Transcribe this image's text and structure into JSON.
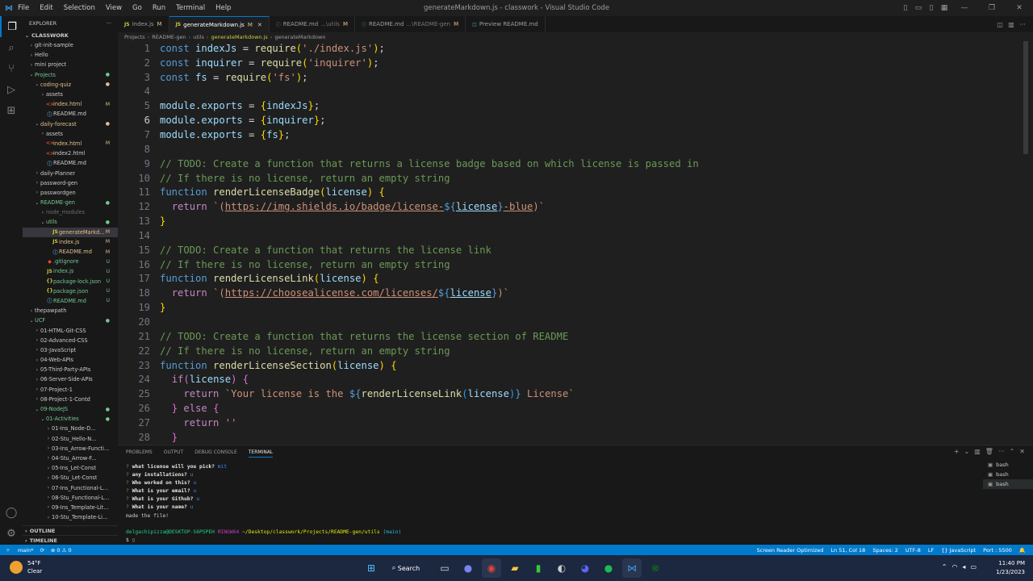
{
  "titlebar": {
    "menu": [
      "File",
      "Edit",
      "Selection",
      "View",
      "Go",
      "Run",
      "Terminal",
      "Help"
    ],
    "title": "generateMarkdown.js - classwork - Visual Studio Code"
  },
  "sidebar": {
    "header": "EXPLORER",
    "root": "CLASSWORK",
    "items": [
      {
        "name": "git-init-sample",
        "depth": 1,
        "type": "folder",
        "open": false,
        "badge": "",
        "badge_color": ""
      },
      {
        "name": "Hello",
        "depth": 1,
        "type": "folder",
        "open": false,
        "badge": "",
        "badge_color": ""
      },
      {
        "name": "mini project",
        "depth": 1,
        "type": "folder",
        "open": false,
        "badge": "",
        "badge_color": ""
      },
      {
        "name": "Projects",
        "depth": 1,
        "type": "folder",
        "open": true,
        "badge": "●",
        "badge_color": "#73c991",
        "color": "#73c991"
      },
      {
        "name": "coding-quiz",
        "depth": 2,
        "type": "folder",
        "open": true,
        "badge": "●",
        "badge_color": "#e2c08d",
        "color": "#e2c08d"
      },
      {
        "name": "assets",
        "depth": 3,
        "type": "folder",
        "open": false,
        "badge": "",
        "badge_color": ""
      },
      {
        "name": "index.html",
        "depth": 3,
        "type": "html",
        "badge": "M",
        "badge_color": "#e2c08d",
        "color": "#e2c08d"
      },
      {
        "name": "README.md",
        "depth": 3,
        "type": "md",
        "badge": "",
        "badge_color": ""
      },
      {
        "name": "daily-forecast",
        "depth": 2,
        "type": "folder",
        "open": true,
        "badge": "●",
        "badge_color": "#e2c08d",
        "color": "#e2c08d"
      },
      {
        "name": "assets",
        "depth": 3,
        "type": "folder",
        "open": false,
        "badge": "",
        "badge_color": ""
      },
      {
        "name": "index.html",
        "depth": 3,
        "type": "html",
        "badge": "M",
        "badge_color": "#e2c08d",
        "color": "#e2c08d"
      },
      {
        "name": "index2.html",
        "depth": 3,
        "type": "html",
        "badge": "",
        "badge_color": ""
      },
      {
        "name": "README.md",
        "depth": 3,
        "type": "md",
        "badge": "",
        "badge_color": ""
      },
      {
        "name": "daily-Planner",
        "depth": 2,
        "type": "folder",
        "open": false,
        "badge": "",
        "badge_color": ""
      },
      {
        "name": "password-gen",
        "depth": 2,
        "type": "folder",
        "open": false,
        "badge": "",
        "badge_color": ""
      },
      {
        "name": "passwordgen",
        "depth": 2,
        "type": "folder",
        "open": false,
        "badge": "",
        "badge_color": ""
      },
      {
        "name": "README-gen",
        "depth": 2,
        "type": "folder",
        "open": true,
        "badge": "●",
        "badge_color": "#73c991",
        "color": "#73c991"
      },
      {
        "name": "node_modules",
        "depth": 3,
        "type": "folder",
        "open": false,
        "badge": "",
        "badge_color": "",
        "color": "#6e6e6e"
      },
      {
        "name": "utils",
        "depth": 3,
        "type": "folder",
        "open": true,
        "badge": "●",
        "badge_color": "#73c991",
        "color": "#73c991"
      },
      {
        "name": "generateMarkd...",
        "depth": 4,
        "type": "js",
        "badge": "M",
        "badge_color": "#e2c08d",
        "color": "#e2c08d",
        "selected": true
      },
      {
        "name": "index.js",
        "depth": 4,
        "type": "js",
        "badge": "M",
        "badge_color": "#e2c08d",
        "color": "#e2c08d"
      },
      {
        "name": "README.md",
        "depth": 4,
        "type": "md",
        "badge": "M",
        "badge_color": "#e2c08d",
        "color": "#e2c08d"
      },
      {
        "name": ".gitignore",
        "depth": 3,
        "type": "git",
        "badge": "U",
        "badge_color": "#73c991",
        "color": "#73c991"
      },
      {
        "name": "index.js",
        "depth": 3,
        "type": "js",
        "badge": "U",
        "badge_color": "#73c991",
        "color": "#73c991"
      },
      {
        "name": "package-lock.json",
        "depth": 3,
        "type": "json",
        "badge": "U",
        "badge_color": "#73c991",
        "color": "#73c991"
      },
      {
        "name": "package.json",
        "depth": 3,
        "type": "json",
        "badge": "U",
        "badge_color": "#73c991",
        "color": "#73c991"
      },
      {
        "name": "README.md",
        "depth": 3,
        "type": "md",
        "badge": "U",
        "badge_color": "#73c991",
        "color": "#73c991"
      },
      {
        "name": "thepawpath",
        "depth": 1,
        "type": "folder",
        "open": false,
        "badge": "",
        "badge_color": ""
      },
      {
        "name": "UCF",
        "depth": 1,
        "type": "folder",
        "open": true,
        "badge": "●",
        "badge_color": "#73c991",
        "color": "#73c991"
      },
      {
        "name": "01-HTML-Git-CSS",
        "depth": 2,
        "type": "folder",
        "open": false,
        "badge": "",
        "badge_color": ""
      },
      {
        "name": "02-Advanced-CSS",
        "depth": 2,
        "type": "folder",
        "open": false,
        "badge": "",
        "badge_color": ""
      },
      {
        "name": "03-JavaScript",
        "depth": 2,
        "type": "folder",
        "open": false,
        "badge": "",
        "badge_color": ""
      },
      {
        "name": "04-Web-APIs",
        "depth": 2,
        "type": "folder",
        "open": false,
        "badge": "",
        "badge_color": ""
      },
      {
        "name": "05-Third-Party-APIs",
        "depth": 2,
        "type": "folder",
        "open": false,
        "badge": "",
        "badge_color": ""
      },
      {
        "name": "06-Server-Side-APIs",
        "depth": 2,
        "type": "folder",
        "open": false,
        "badge": "",
        "badge_color": ""
      },
      {
        "name": "07-Project-1",
        "depth": 2,
        "type": "folder",
        "open": false,
        "badge": "",
        "badge_color": ""
      },
      {
        "name": "08-Project-1-Contd",
        "depth": 2,
        "type": "folder",
        "open": false,
        "badge": "",
        "badge_color": ""
      },
      {
        "name": "09-NodeJS",
        "depth": 2,
        "type": "folder",
        "open": true,
        "badge": "●",
        "badge_color": "#73c991",
        "color": "#73c991"
      },
      {
        "name": "01-Activities",
        "depth": 3,
        "type": "folder",
        "open": true,
        "badge": "●",
        "badge_color": "#73c991",
        "color": "#73c991"
      },
      {
        "name": "01-Ins_Node-D...",
        "depth": 4,
        "type": "folder",
        "open": false,
        "badge": "",
        "badge_color": ""
      },
      {
        "name": "02-Stu_Hello-N...",
        "depth": 4,
        "type": "folder",
        "open": false,
        "badge": "",
        "badge_color": ""
      },
      {
        "name": "03-Ins_Arrow-Function",
        "depth": 4,
        "type": "folder",
        "open": false,
        "badge": "",
        "badge_color": ""
      },
      {
        "name": "04-Stu_Arrow-F...",
        "depth": 4,
        "type": "folder",
        "open": false,
        "badge": "",
        "badge_color": ""
      },
      {
        "name": "05-Ins_Let-Const",
        "depth": 4,
        "type": "folder",
        "open": false,
        "badge": "",
        "badge_color": ""
      },
      {
        "name": "06-Stu_Let-Const",
        "depth": 4,
        "type": "folder",
        "open": false,
        "badge": "",
        "badge_color": ""
      },
      {
        "name": "07-Ins_Functional-Lo...",
        "depth": 4,
        "type": "folder",
        "open": false,
        "badge": "",
        "badge_color": ""
      },
      {
        "name": "08-Stu_Functional-Lo...",
        "depth": 4,
        "type": "folder",
        "open": false,
        "badge": "",
        "badge_color": ""
      },
      {
        "name": "09-Ins_Template-Lite...",
        "depth": 4,
        "type": "folder",
        "open": false,
        "badge": "",
        "badge_color": ""
      },
      {
        "name": "10-Stu_Template-Lite...",
        "depth": 4,
        "type": "folder",
        "open": false,
        "badge": "",
        "badge_color": ""
      }
    ],
    "outline_label": "OUTLINE",
    "timeline_label": "TIMELINE"
  },
  "tabs": [
    {
      "icon": "JS",
      "label": "index.js",
      "desc": "",
      "mod": "M",
      "active": false
    },
    {
      "icon": "JS",
      "label": "generateMarkdown.js",
      "desc": "",
      "mod": "M",
      "active": true
    },
    {
      "icon": "md",
      "label": "README.md",
      "desc": "...\\utils",
      "mod": "M",
      "active": false
    },
    {
      "icon": "md",
      "label": "README.md",
      "desc": "...\\README-gen",
      "mod": "M",
      "active": false
    },
    {
      "icon": "pv",
      "label": "Preview README.md",
      "desc": "",
      "mod": "",
      "active": false
    }
  ],
  "breadcrumb": [
    "Projects",
    "README-gen",
    "utils",
    "generateMarkdown.js",
    "generateMarkdown"
  ],
  "code_lines": [
    {
      "n": "1",
      "parts": [
        [
          "kw",
          "const "
        ],
        [
          "var",
          "indexJs"
        ],
        [
          "pun",
          " = "
        ],
        [
          "fn",
          "require"
        ],
        [
          "brk",
          "("
        ],
        [
          "str",
          "'./index.js'"
        ],
        [
          "brk",
          ")"
        ],
        [
          "pun",
          ";"
        ]
      ]
    },
    {
      "n": "2",
      "parts": [
        [
          "kw",
          "const "
        ],
        [
          "var",
          "inquirer"
        ],
        [
          "pun",
          " = "
        ],
        [
          "fn",
          "require"
        ],
        [
          "brk",
          "("
        ],
        [
          "str",
          "'inquirer'"
        ],
        [
          "brk",
          ")"
        ],
        [
          "pun",
          ";"
        ]
      ]
    },
    {
      "n": "3",
      "parts": [
        [
          "kw",
          "const "
        ],
        [
          "var",
          "fs"
        ],
        [
          "pun",
          " = "
        ],
        [
          "fn",
          "require"
        ],
        [
          "brk",
          "("
        ],
        [
          "str",
          "'fs'"
        ],
        [
          "brk",
          ")"
        ],
        [
          "pun",
          ";"
        ]
      ]
    },
    {
      "n": "4",
      "parts": []
    },
    {
      "n": "5",
      "parts": [
        [
          "var",
          "module"
        ],
        [
          "pun",
          "."
        ],
        [
          "var",
          "exports"
        ],
        [
          "pun",
          " = "
        ],
        [
          "brk",
          "{"
        ],
        [
          "var",
          "indexJs"
        ],
        [
          "brk",
          "}"
        ],
        [
          "pun",
          ";"
        ]
      ]
    },
    {
      "n": "6",
      "parts": [
        [
          "var",
          "module"
        ],
        [
          "pun",
          "."
        ],
        [
          "var",
          "exports"
        ],
        [
          "pun",
          " = "
        ],
        [
          "brk",
          "{"
        ],
        [
          "var",
          "inquirer"
        ],
        [
          "brk",
          "}"
        ],
        [
          "pun",
          ";"
        ]
      ]
    },
    {
      "n": "7",
      "parts": [
        [
          "var",
          "module"
        ],
        [
          "pun",
          "."
        ],
        [
          "var",
          "exports"
        ],
        [
          "pun",
          " = "
        ],
        [
          "brk",
          "{"
        ],
        [
          "var",
          "fs"
        ],
        [
          "brk",
          "}"
        ],
        [
          "pun",
          ";"
        ]
      ]
    },
    {
      "n": "8",
      "parts": []
    },
    {
      "n": "9",
      "parts": [
        [
          "cmt",
          "// TODO: Create a function that returns a license badge based on which license is passed in"
        ]
      ]
    },
    {
      "n": "10",
      "parts": [
        [
          "cmt",
          "// If there is no license, return an empty string"
        ]
      ]
    },
    {
      "n": "11",
      "parts": [
        [
          "kw",
          "function "
        ],
        [
          "fn",
          "renderLicenseBadge"
        ],
        [
          "brk",
          "("
        ],
        [
          "var",
          "license"
        ],
        [
          "brk",
          ")"
        ],
        [
          "pun",
          " "
        ],
        [
          "brk",
          "{"
        ]
      ]
    },
    {
      "n": "12",
      "parts": [
        [
          "pun",
          "  "
        ],
        [
          "ctl",
          "return "
        ],
        [
          "str",
          "`("
        ],
        [
          "str url",
          "https://img.shields.io/badge/license-"
        ],
        [
          "tpl",
          "${"
        ],
        [
          "var url",
          "license"
        ],
        [
          "tpl",
          "}"
        ],
        [
          "str url",
          "-blue"
        ],
        [
          "str",
          ")`"
        ]
      ]
    },
    {
      "n": "13",
      "parts": [
        [
          "brk",
          "}"
        ]
      ]
    },
    {
      "n": "14",
      "parts": []
    },
    {
      "n": "15",
      "parts": [
        [
          "cmt",
          "// TODO: Create a function that returns the license link"
        ]
      ]
    },
    {
      "n": "16",
      "parts": [
        [
          "cmt",
          "// If there is no license, return an empty string"
        ]
      ]
    },
    {
      "n": "17",
      "parts": [
        [
          "kw",
          "function "
        ],
        [
          "fn",
          "renderLicenseLink"
        ],
        [
          "brk",
          "("
        ],
        [
          "var",
          "license"
        ],
        [
          "brk",
          ")"
        ],
        [
          "pun",
          " "
        ],
        [
          "brk",
          "{"
        ]
      ]
    },
    {
      "n": "18",
      "parts": [
        [
          "pun",
          "  "
        ],
        [
          "ctl",
          "return "
        ],
        [
          "str",
          "`("
        ],
        [
          "str url",
          "https://choosealicense.com/licenses/"
        ],
        [
          "tpl",
          "${"
        ],
        [
          "var url",
          "license"
        ],
        [
          "tpl",
          "}"
        ],
        [
          "str",
          ")`"
        ]
      ]
    },
    {
      "n": "19",
      "parts": [
        [
          "brk",
          "}"
        ]
      ]
    },
    {
      "n": "20",
      "parts": []
    },
    {
      "n": "21",
      "parts": [
        [
          "cmt",
          "// TODO: Create a function that returns the license section of README"
        ]
      ]
    },
    {
      "n": "22",
      "parts": [
        [
          "cmt",
          "// If there is no license, return an empty string"
        ]
      ]
    },
    {
      "n": "23",
      "parts": [
        [
          "kw",
          "function "
        ],
        [
          "fn",
          "renderLicenseSection"
        ],
        [
          "brk",
          "("
        ],
        [
          "var",
          "license"
        ],
        [
          "brk",
          ")"
        ],
        [
          "pun",
          " "
        ],
        [
          "brk",
          "{"
        ]
      ]
    },
    {
      "n": "24",
      "parts": [
        [
          "pun",
          "  "
        ],
        [
          "ctl",
          "if"
        ],
        [
          "brk2",
          "("
        ],
        [
          "var",
          "license"
        ],
        [
          "brk2",
          ")"
        ],
        [
          "pun",
          " "
        ],
        [
          "brk2",
          "{"
        ]
      ]
    },
    {
      "n": "25",
      "parts": [
        [
          "pun",
          "    "
        ],
        [
          "ctl",
          "return "
        ],
        [
          "str",
          "`Your license is the "
        ],
        [
          "tpl",
          "${"
        ],
        [
          "fn",
          "renderLicenseLink"
        ],
        [
          "brk3",
          "("
        ],
        [
          "var",
          "license"
        ],
        [
          "brk3",
          ")"
        ],
        [
          "tpl",
          "}"
        ],
        [
          "str",
          " License`"
        ]
      ]
    },
    {
      "n": "26",
      "parts": [
        [
          "pun",
          "  "
        ],
        [
          "brk2",
          "}"
        ],
        [
          "ctl",
          " else "
        ],
        [
          "brk2",
          "{"
        ]
      ]
    },
    {
      "n": "27",
      "parts": [
        [
          "pun",
          "    "
        ],
        [
          "ctl",
          "return "
        ],
        [
          "str",
          "''"
        ]
      ]
    },
    {
      "n": "28",
      "parts": [
        [
          "pun",
          "  "
        ],
        [
          "brk2",
          "}"
        ]
      ]
    }
  ],
  "panel": {
    "tabs": [
      "PROBLEMS",
      "OUTPUT",
      "DEBUG CONSOLE",
      "TERMINAL"
    ],
    "active_tab": "TERMINAL",
    "terminal_lines": [
      {
        "q": "?",
        "text": "what license will you pick?",
        "ans": "mit"
      },
      {
        "q": "?",
        "text": "any installations?",
        "ans": "u"
      },
      {
        "q": "?",
        "text": "Who worked on this?",
        "ans": "u"
      },
      {
        "q": "?",
        "text": "What is your email?",
        "ans": "u"
      },
      {
        "q": "?",
        "text": "What is your Github?",
        "ans": "u"
      },
      {
        "q": "?",
        "text": "What is your name?",
        "ans": "u"
      },
      {
        "q": "",
        "text": "made the file!",
        "ans": ""
      }
    ],
    "prompt": {
      "user": "delgachipizza@DESKTOP-S6PSPEH",
      "shell": "MINGW64",
      "path": "~/Desktop/classwork/Projects/README-gen/utils",
      "branch": "(main)",
      "cursor": "$"
    },
    "terminal_list": [
      "bash",
      "bash",
      "bash"
    ]
  },
  "statusbar": {
    "branch": "main*",
    "sync": "⟳",
    "problems": "⊗ 0 ⚠ 0",
    "right": [
      "Screen Reader Optimized",
      "Ln 51, Col 18",
      "Spaces: 2",
      "UTF-8",
      "LF",
      "{} JavaScript",
      "Port : 5500"
    ]
  },
  "taskbar": {
    "weather_temp": "54°F",
    "weather_desc": "Clear",
    "search_label": "Search",
    "time": "11:40 PM",
    "date": "1/23/2023"
  }
}
